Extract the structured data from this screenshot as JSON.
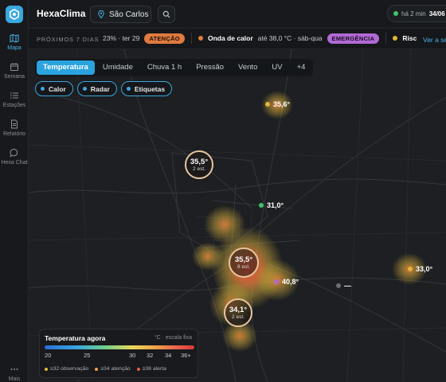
{
  "app": {
    "title": "HexaClima",
    "city": "São Carlos"
  },
  "status": {
    "updated": "há 2 min",
    "time": "34/06"
  },
  "nav": [
    {
      "label": "Mapa",
      "icon": "map-icon",
      "active": true
    },
    {
      "label": "Semana",
      "icon": "calendar-icon"
    },
    {
      "label": "Estações",
      "icon": "list-icon"
    },
    {
      "label": "Relatório",
      "icon": "document-icon"
    },
    {
      "label": "Hexa Chat",
      "icon": "chat-icon"
    },
    {
      "label": "Mais",
      "icon": "more-icon"
    }
  ],
  "ticker": {
    "label": "PRÓXIMOS 7 DIAS",
    "items": [
      {
        "text": "23% · ter 29",
        "badge": "ATENÇÃO"
      },
      {
        "title": "Onda de calor",
        "text": "até 38,0 °C · sáb-qua",
        "badge": "EMERGÊNCIA",
        "dot_color": "#e07a3f"
      },
      {
        "title": "Risc",
        "dot_color": "#e6b43a"
      }
    ],
    "see_all": "Ver a se"
  },
  "tabs": [
    "Temperatura",
    "Umidade",
    "Chuva 1 h",
    "Pressão",
    "Vento",
    "UV",
    "+4"
  ],
  "chips": [
    "Calor",
    "Radar",
    "Etiquetas"
  ],
  "markers": {
    "m1": {
      "value": "35,6°",
      "color": "#e6b43a"
    },
    "m2": {
      "value": "31,0°",
      "color": "#3fc46a"
    },
    "m3": {
      "value": "40,8°",
      "color": "#b06ad4"
    },
    "m4": {
      "value": "33,0°",
      "color": "#e6b43a"
    },
    "m5": {
      "value": "—",
      "color": "#6a6f75"
    }
  },
  "clusters": {
    "c1": {
      "value": "35,5°",
      "stations": "2 est."
    },
    "c2": {
      "value": "35,5°",
      "stations": "8 est."
    },
    "c3": {
      "value": "34,1°",
      "stations": "2 est."
    }
  },
  "legend": {
    "title": "Temperatura agora",
    "unit": "°C · escala fixa",
    "ticks": [
      "20",
      "25",
      "30",
      "32",
      "34",
      "36+"
    ],
    "keys": [
      {
        "label": "≥32 observação",
        "color": "#e6b43a"
      },
      {
        "label": "≥34 atenção",
        "color": "#eea24a"
      },
      {
        "label": "≥36 alerta",
        "color": "#e85a4a"
      }
    ]
  }
}
